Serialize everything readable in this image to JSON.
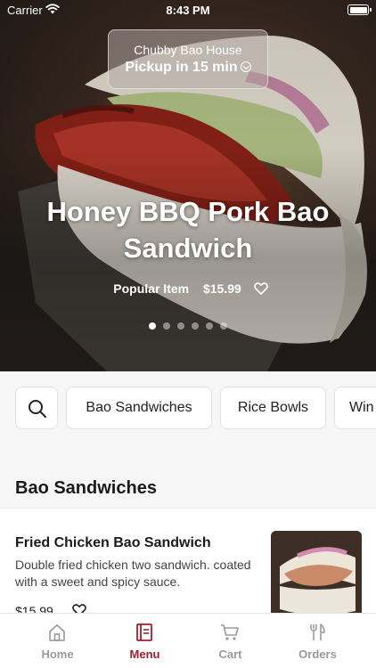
{
  "status_bar": {
    "carrier": "Carrier",
    "time": "8:43 PM"
  },
  "store": {
    "name": "Chubby Bao House",
    "pickup": "Pickup in 15 min"
  },
  "featured": {
    "title": "Honey BBQ Pork Bao Sandwich",
    "badge": "Popular Item",
    "price": "$15.99",
    "slide_count": 6,
    "active_slide": 1
  },
  "categories": [
    "Bao Sandwiches",
    "Rice Bowls",
    "Win"
  ],
  "menu_section": {
    "title": "Bao Sandwiches",
    "items": [
      {
        "name": "Fried Chicken Bao Sandwich",
        "description": "Double fried chicken two sandwich. coated with a sweet and spicy sauce.",
        "price": "$15.99"
      }
    ]
  },
  "tabs": [
    {
      "label": "Home",
      "icon": "home-icon",
      "active": false
    },
    {
      "label": "Menu",
      "icon": "menu-icon",
      "active": true
    },
    {
      "label": "Cart",
      "icon": "cart-icon",
      "active": false
    },
    {
      "label": "Orders",
      "icon": "utensils-icon",
      "active": false
    }
  ],
  "colors": {
    "accent": "#a51d2d",
    "inactive_tab": "#9a9a9a",
    "background": "#f6f6f6"
  }
}
